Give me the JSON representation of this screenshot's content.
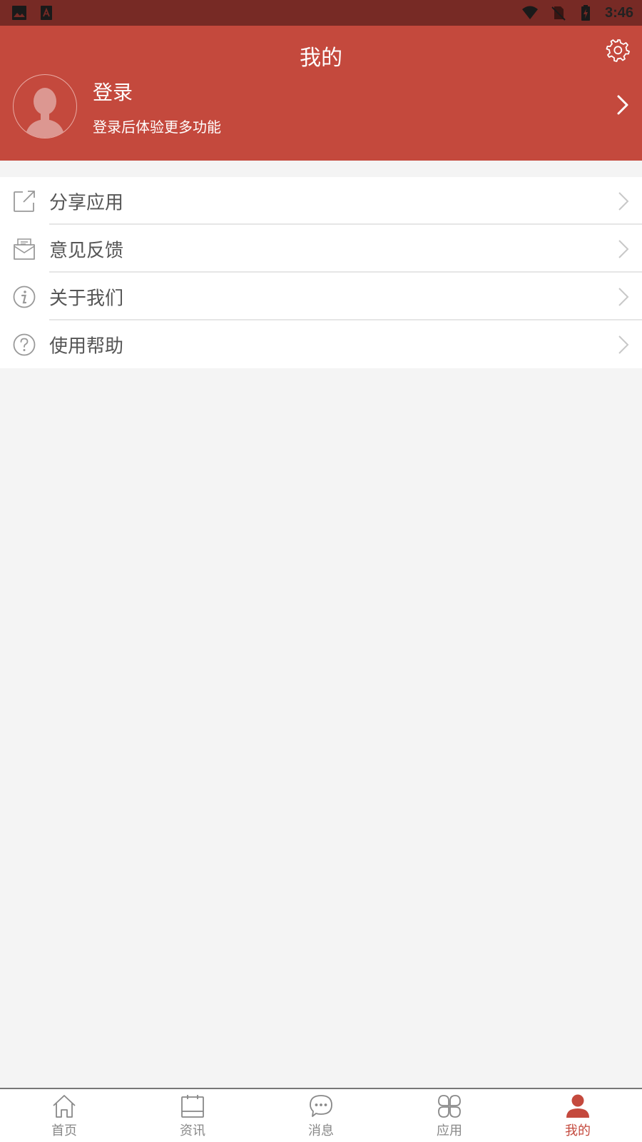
{
  "status_bar": {
    "time": "3:46",
    "left_icons": [
      "image-icon",
      "text-a-icon"
    ],
    "right_icons": [
      "wifi-icon",
      "no-sim-icon",
      "battery-charging-icon"
    ]
  },
  "header": {
    "title": "我的",
    "login_title": "登录",
    "login_subtitle": "登录后体验更多功能",
    "background_color": "#c4493d",
    "settings_icon": "gear-icon"
  },
  "menu": {
    "items": [
      {
        "label": "分享应用",
        "icon": "share-icon"
      },
      {
        "label": "意见反馈",
        "icon": "feedback-mail-icon"
      },
      {
        "label": "关于我们",
        "icon": "info-icon"
      },
      {
        "label": "使用帮助",
        "icon": "help-icon"
      }
    ]
  },
  "bottom_nav": {
    "active_index": 4,
    "active_color": "#c4493d",
    "items": [
      {
        "label": "首页",
        "icon": "home-icon"
      },
      {
        "label": "资讯",
        "icon": "news-calendar-icon"
      },
      {
        "label": "消息",
        "icon": "message-bubble-icon"
      },
      {
        "label": "应用",
        "icon": "apps-icon"
      },
      {
        "label": "我的",
        "icon": "user-icon"
      }
    ]
  }
}
